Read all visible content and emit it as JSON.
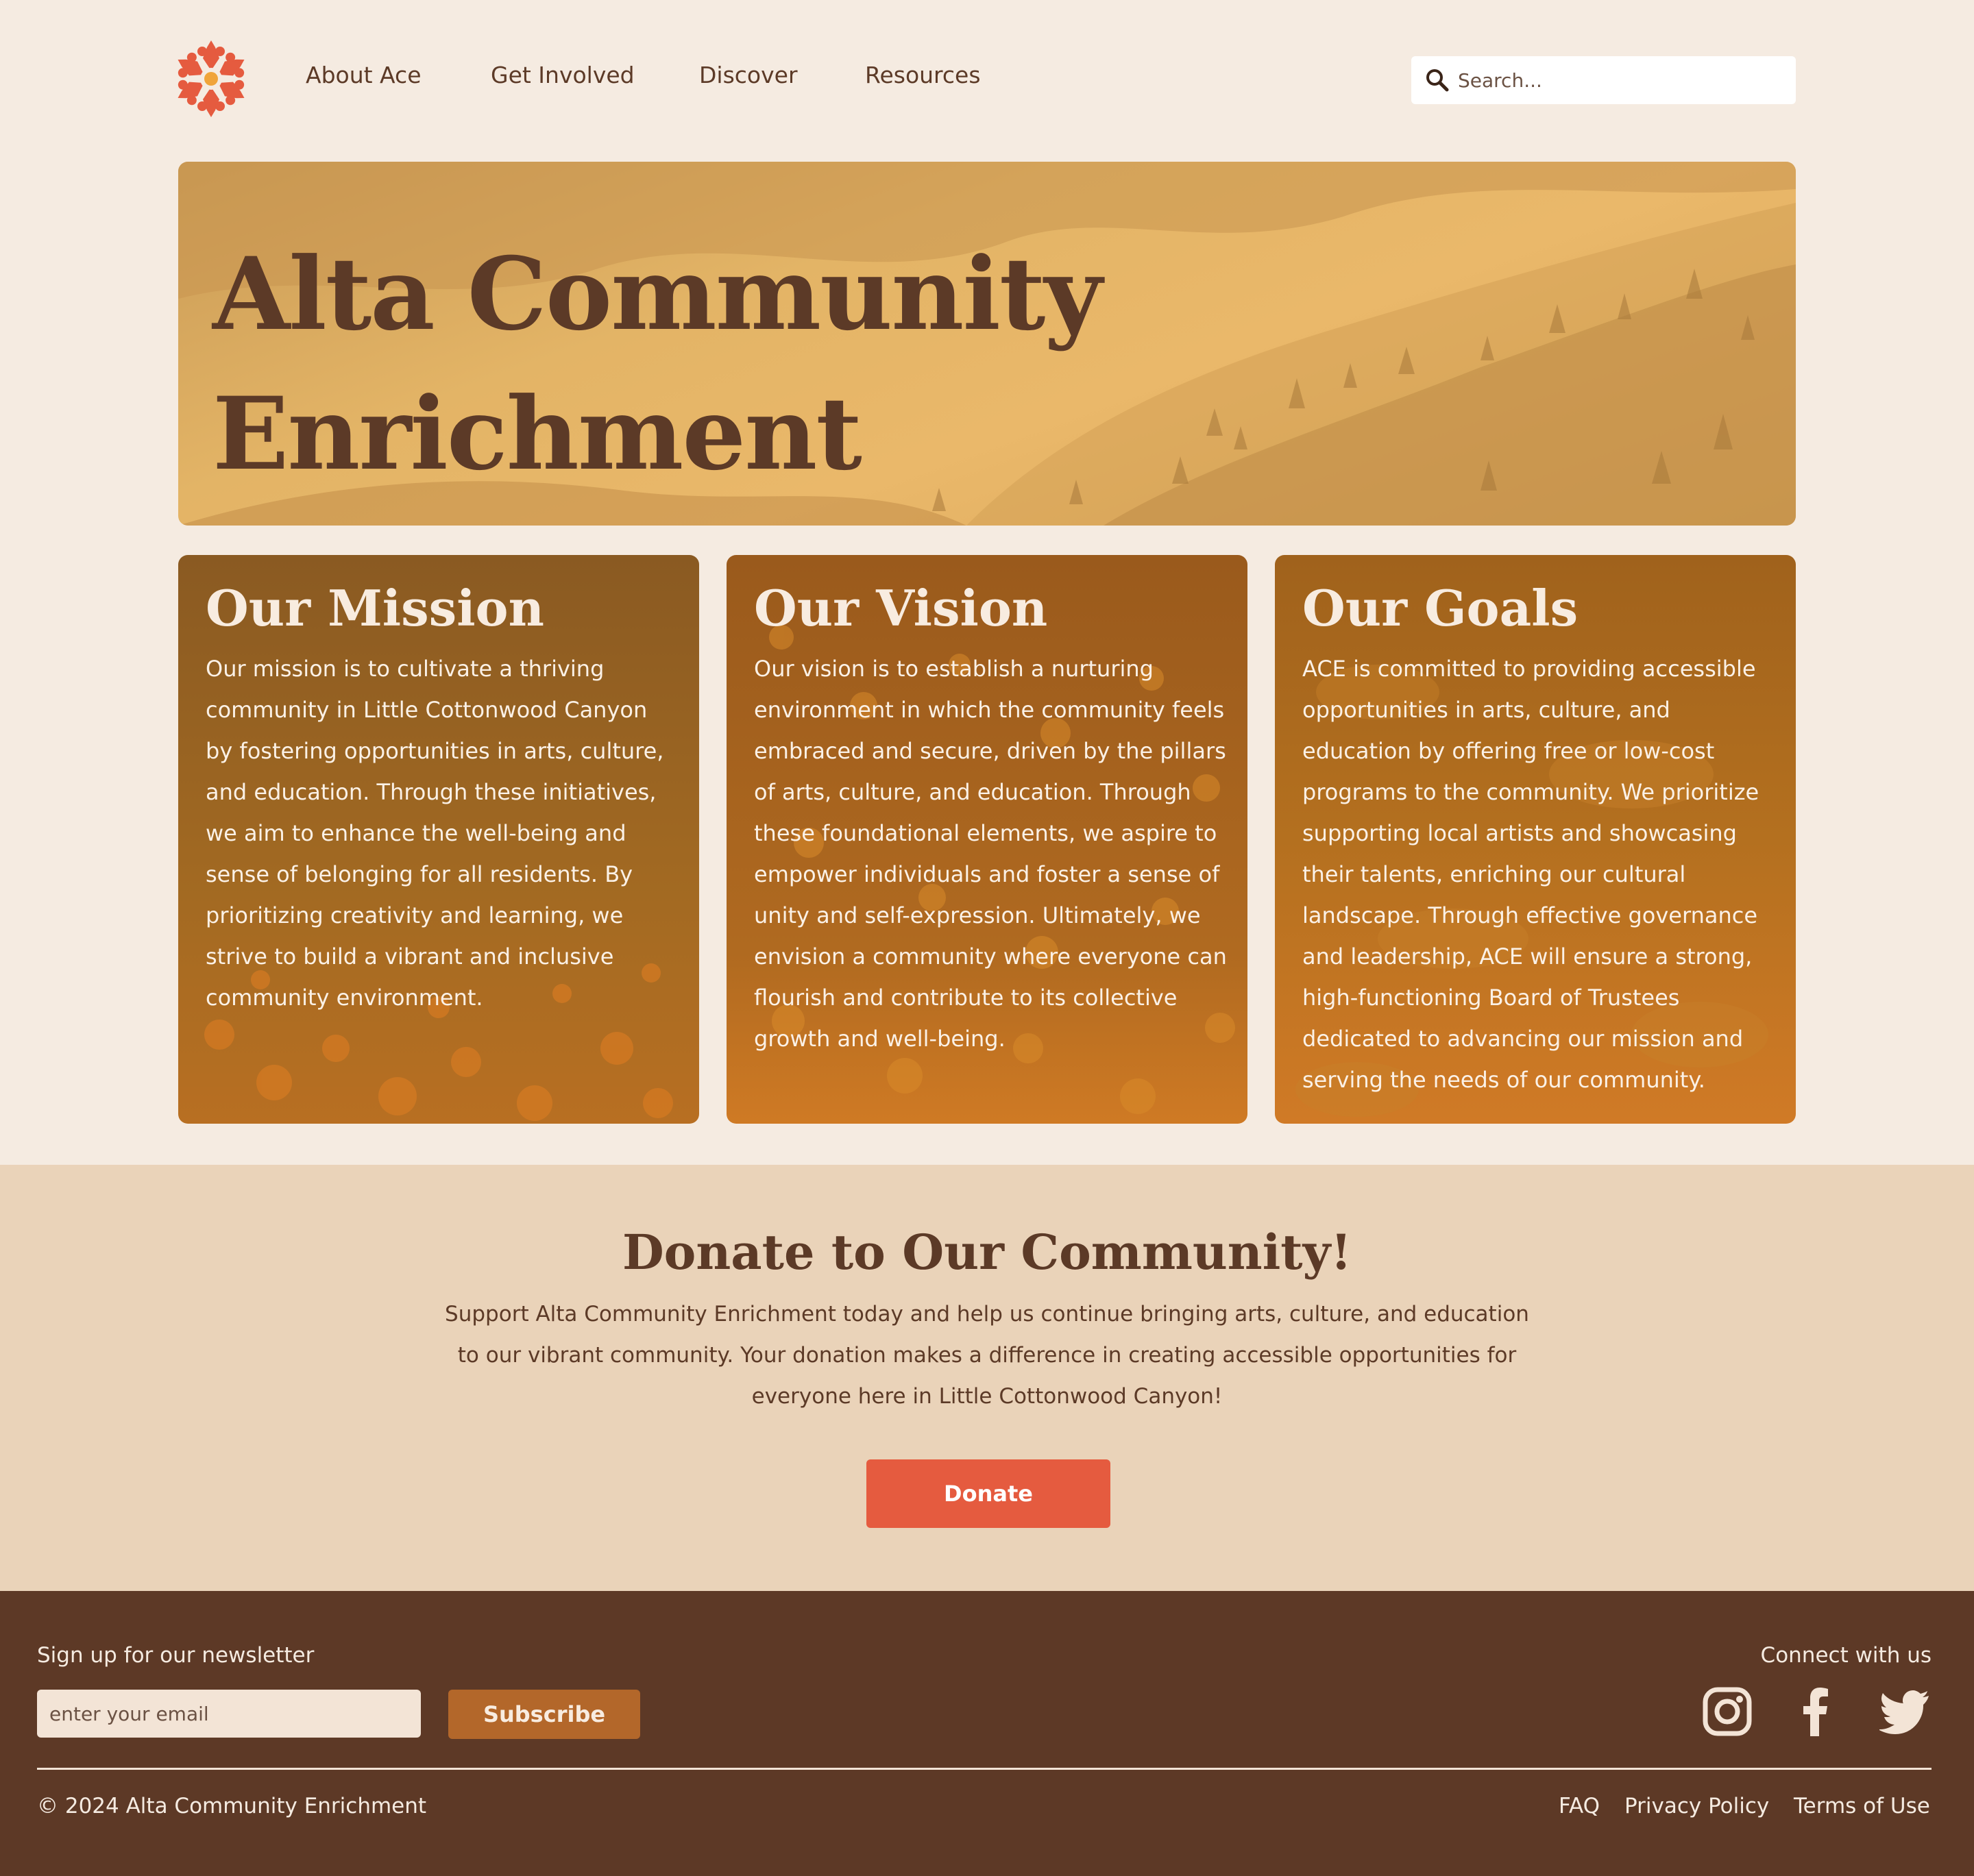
{
  "header": {
    "logo_name": "ace-snowflake-logo",
    "nav": [
      {
        "label": "About Ace"
      },
      {
        "label": "Get Involved"
      },
      {
        "label": "Discover"
      },
      {
        "label": "Resources"
      }
    ],
    "search": {
      "placeholder": "Search...",
      "icon": "search-icon"
    }
  },
  "hero": {
    "title_line1": "Alta Community",
    "title_line2": "Enrichment"
  },
  "cards": [
    {
      "title": "Our Mission",
      "text": "Our mission is to cultivate a thriving community in Little Cottonwood Canyon by fostering opportunities in arts, culture, and education. Through these initiatives, we aim to enhance the well-being and sense of belonging for all residents. By prioritizing creativity and learning, we strive to build a vibrant and inclusive community environment."
    },
    {
      "title": "Our Vision",
      "text": "Our vision is to establish a nurturing environment in which the community feels embraced and secure, driven by the pillars of arts, culture, and education. Through these foundational elements, we aspire to empower individuals and foster a sense of unity and self-expression. Ultimately, we envision a community where everyone can flourish and contribute to its collective growth and well-being."
    },
    {
      "title": "Our Goals",
      "text": "ACE is committed to providing accessible opportunities in arts, culture, and education by offering free or low-cost programs to the community. We prioritize supporting local artists and showcasing their talents, enriching our cultural landscape. Through effective governance and leadership, ACE will ensure a strong, high-functioning Board of Trustees dedicated to advancing our mission and serving the needs of our community."
    }
  ],
  "donate": {
    "title": "Donate to Our Community!",
    "text": "Support Alta Community Enrichment today and help us continue bringing arts, culture, and education to our vibrant community. Your donation makes a difference in creating accessible opportunities for everyone here in Little Cottonwood Canyon!",
    "button": "Donate"
  },
  "footer": {
    "newsletter_label": "Sign up for our newsletter",
    "email_placeholder": "enter your email",
    "subscribe": "Subscribe",
    "connect_label": "Connect with us",
    "social": [
      "instagram-icon",
      "facebook-icon",
      "twitter-icon"
    ],
    "copyright": "© 2024 Alta Community Enrichment",
    "links": [
      {
        "label": "FAQ"
      },
      {
        "label": "Privacy Policy"
      },
      {
        "label": "Terms of Use"
      }
    ]
  },
  "colors": {
    "page_bg": "#f5ebe1",
    "brown": "#5c3a27",
    "accent_red": "#e55b3f",
    "donate_bg": "#ead3b9",
    "footer_bg": "#5d3926",
    "subscribe": "#b3672a",
    "hero_gold": "#e3b466"
  }
}
